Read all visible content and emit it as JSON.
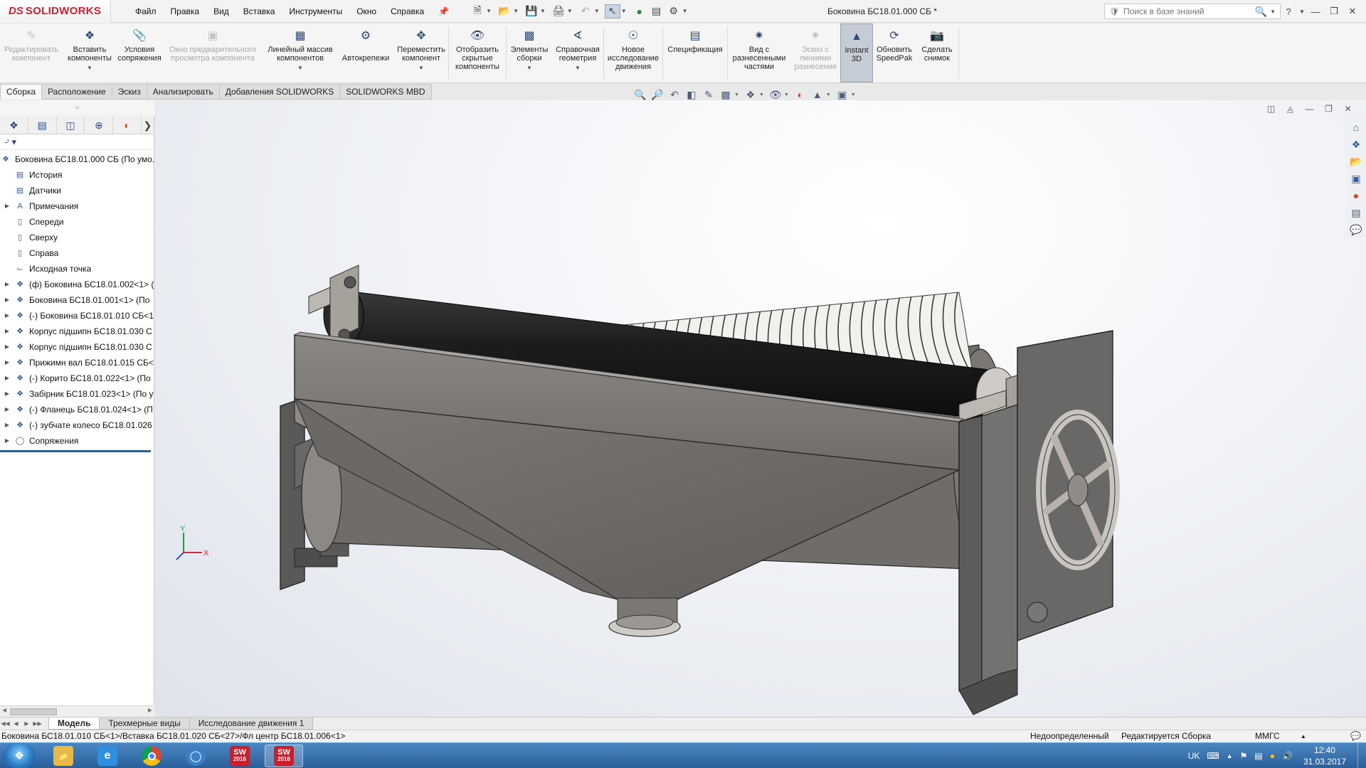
{
  "app": {
    "logo_prefix": "DS",
    "logo_text": "SOLIDWORKS",
    "document_title": "Боковина БС18.01.000 СБ *"
  },
  "menu": [
    "Файл",
    "Правка",
    "Вид",
    "Вставка",
    "Инструменты",
    "Окно",
    "Справка"
  ],
  "search": {
    "placeholder": "Поиск в базе знаний"
  },
  "command_manager": {
    "edit_component": "Редактировать компонент",
    "insert_components": "Вставить компоненты",
    "mate": "Условия сопряжения",
    "component_preview": "Окно предварительного просмотра компонента",
    "linear_pattern": "Линейный массив компонентов",
    "smart_fasteners": "Автокрепежи",
    "move_component": "Переместить компонент",
    "show_hidden": "Отобразить скрытые компоненты",
    "assembly_features": "Элементы сборки",
    "reference_geometry": "Справочная геометрия",
    "new_motion_study": "Новое исследование движения",
    "bom": "Спецификация",
    "exploded_view": "Вид с разнесенными частями",
    "explode_line_sketch": "Эскиз с линиями разнесения",
    "instant3d": "Instant 3D",
    "update_speedpak": "Обновить SpeedPak",
    "take_snapshot": "Сделать снимок"
  },
  "ribbon_tabs": [
    "Сборка",
    "Расположение",
    "Эскиз",
    "Анализировать",
    "Добавления SOLIDWORKS",
    "SOLIDWORKS MBD"
  ],
  "feature_tree": {
    "root": "Боковина БС18.01.000 СБ  (По умо...",
    "items": [
      {
        "label": "История",
        "expandable": false,
        "icon": "history-icon"
      },
      {
        "label": "Датчики",
        "expandable": false,
        "icon": "sensors-icon"
      },
      {
        "label": "Примечания",
        "expandable": true,
        "icon": "annotations-icon"
      },
      {
        "label": "Спереди",
        "expandable": false,
        "icon": "plane-icon"
      },
      {
        "label": "Сверху",
        "expandable": false,
        "icon": "plane-icon"
      },
      {
        "label": "Справа",
        "expandable": false,
        "icon": "plane-icon"
      },
      {
        "label": "Исходная точка",
        "expandable": false,
        "icon": "origin-icon"
      },
      {
        "label": "(ф) Боковина БС18.01.002<1> (",
        "expandable": true,
        "icon": "part-icon"
      },
      {
        "label": "Боковина БС18.01.001<1> (По",
        "expandable": true,
        "icon": "part-icon"
      },
      {
        "label": "(-) Боковина БС18.01.010 СБ<1",
        "expandable": true,
        "icon": "part-icon"
      },
      {
        "label": "Корпус підшипн БС18.01.030 С",
        "expandable": true,
        "icon": "part-icon"
      },
      {
        "label": "Корпус підшипн БС18.01.030 С",
        "expandable": true,
        "icon": "part-icon"
      },
      {
        "label": "Прижимн вал БС18.01.015 СБ<",
        "expandable": true,
        "icon": "part-icon"
      },
      {
        "label": "(-) Корито БС18.01.022<1> (По",
        "expandable": true,
        "icon": "part-icon"
      },
      {
        "label": "Забірник БС18.01.023<1> (По у",
        "expandable": true,
        "icon": "part-icon"
      },
      {
        "label": "(-) Фланець БС18.01.024<1> (П",
        "expandable": true,
        "icon": "part-icon"
      },
      {
        "label": "(-) зубчате колесо БС18.01.026",
        "expandable": true,
        "icon": "part-icon"
      },
      {
        "label": "Сопряжения",
        "expandable": true,
        "icon": "mates-icon"
      }
    ]
  },
  "bottom_tabs": [
    "Модель",
    "Трехмерные виды",
    "Исследование движения 1"
  ],
  "status": {
    "path": "Боковина БС18.01.010 СБ<1>/Вставка БС18.01.020 СБ<27>/Фл центр БС18.01.006<1>",
    "definition": "Недоопределенный",
    "mode": "Редактируется Сборка",
    "units": "ММГС"
  },
  "triad": {
    "y": "Y",
    "x": "X"
  },
  "taskbar": {
    "language": "UK",
    "time": "12:40",
    "date": "31.03.2017",
    "sw_year": "2016"
  },
  "colors": {
    "brand": "#d0202f",
    "tree_selection": "#1e5fb4",
    "taskbar": "#2a5f9a"
  }
}
